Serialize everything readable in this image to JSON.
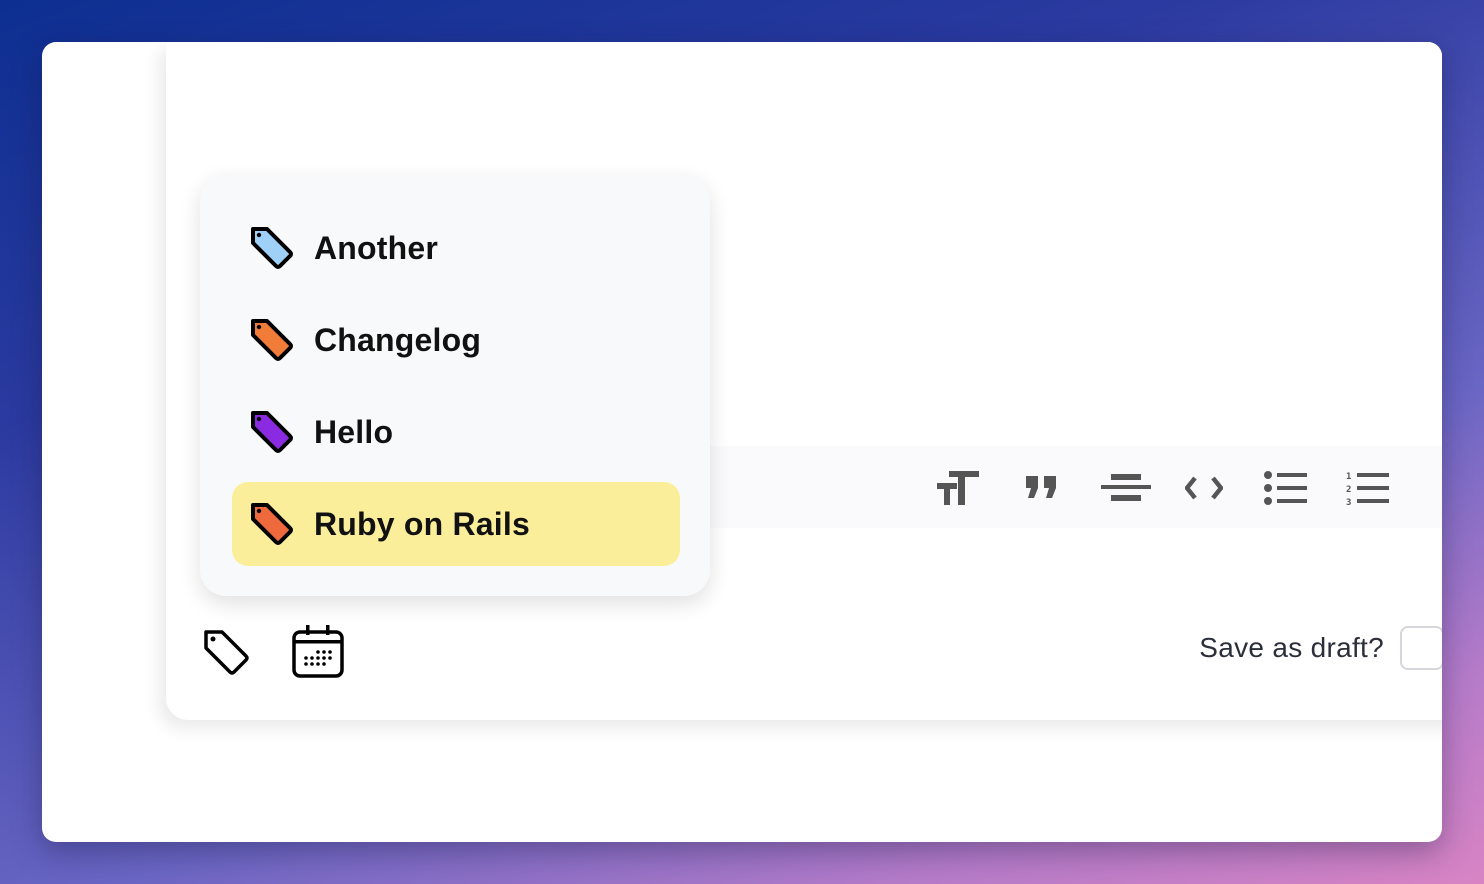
{
  "tag_menu": {
    "items": [
      {
        "label": "Another",
        "icon": "tag-icon",
        "color": "#9fd0f7",
        "selected": false
      },
      {
        "label": "Changelog",
        "icon": "tag-icon",
        "color": "#f07c38",
        "selected": false
      },
      {
        "label": "Hello",
        "icon": "tag-icon",
        "color": "#8a2be2",
        "selected": false
      },
      {
        "label": "Ruby on Rails",
        "icon": "tag-icon",
        "color": "#ee6a3c",
        "selected": true
      }
    ],
    "highlight_color": "#fbee9b"
  },
  "toolbar": {
    "buttons": [
      {
        "name": "text-size",
        "icon": "text-size-icon"
      },
      {
        "name": "quote",
        "icon": "quote-icon"
      },
      {
        "name": "strikethrough",
        "icon": "strikethrough-icon"
      },
      {
        "name": "code",
        "icon": "code-icon"
      },
      {
        "name": "bullet-list",
        "icon": "bullet-list-icon"
      },
      {
        "name": "numbered-list",
        "icon": "numbered-list-icon"
      }
    ]
  },
  "footer": {
    "tag_button_icon": "tag-icon",
    "schedule_button_icon": "calendar-icon",
    "draft_label": "Save as draft?",
    "draft_checked": false
  }
}
